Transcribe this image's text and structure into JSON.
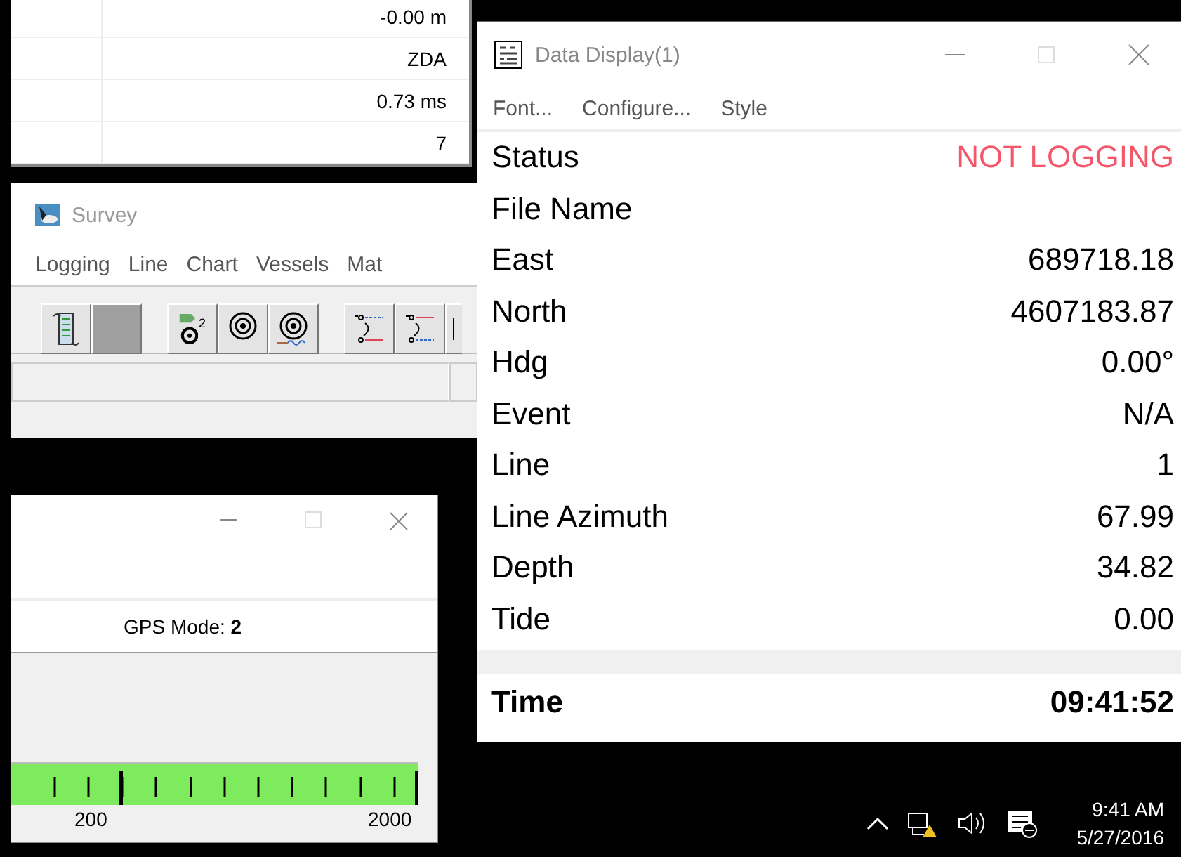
{
  "readout_window": {
    "rows": [
      {
        "value": "-0.00 m"
      },
      {
        "value": "ZDA"
      },
      {
        "value": "0.73 ms"
      },
      {
        "value": "7"
      }
    ]
  },
  "survey_window": {
    "title": "Survey",
    "menu": [
      "Logging",
      "Line",
      "Chart",
      "Vessels",
      "Mat"
    ],
    "toolbar": [
      {
        "kind": "scroll"
      },
      {
        "kind": "blank"
      },
      {
        "kind": "target-flag",
        "badge": "2"
      },
      {
        "kind": "target"
      },
      {
        "kind": "target-wave"
      },
      {
        "kind": "line-up"
      },
      {
        "kind": "line-down"
      },
      {
        "kind": "cut"
      }
    ]
  },
  "gps_window": {
    "gps_mode": "GPS Mode: **2**",
    "scale_labels": [
      "200",
      "2000"
    ]
  },
  "data_display": {
    "title": "Data Display(1)",
    "menu": [
      "Font...",
      "Configure...",
      "Style"
    ],
    "rows": [
      {
        "label": "Status",
        "value": "NOT LOGGING",
        "alert": true
      },
      {
        "label": "File Name"
      },
      {
        "label": "East",
        "value": "689718.18"
      },
      {
        "label": "North",
        "value": "4607183.87"
      },
      {
        "label": "Hdg",
        "value": "0.00°"
      },
      {
        "label": "Event",
        "value": "N/A"
      },
      {
        "label": "Line",
        "value": "1"
      },
      {
        "label": "Line Azimuth",
        "value": "67.99"
      },
      {
        "label": "Depth",
        "value": "34.82"
      },
      {
        "label": "Tide",
        "value": "0.00"
      }
    ],
    "footer": {
      "label": "Time",
      "value": "09:41:52"
    }
  },
  "taskbar": {
    "time": "9:41 AM",
    "date": "5/27/2016"
  }
}
